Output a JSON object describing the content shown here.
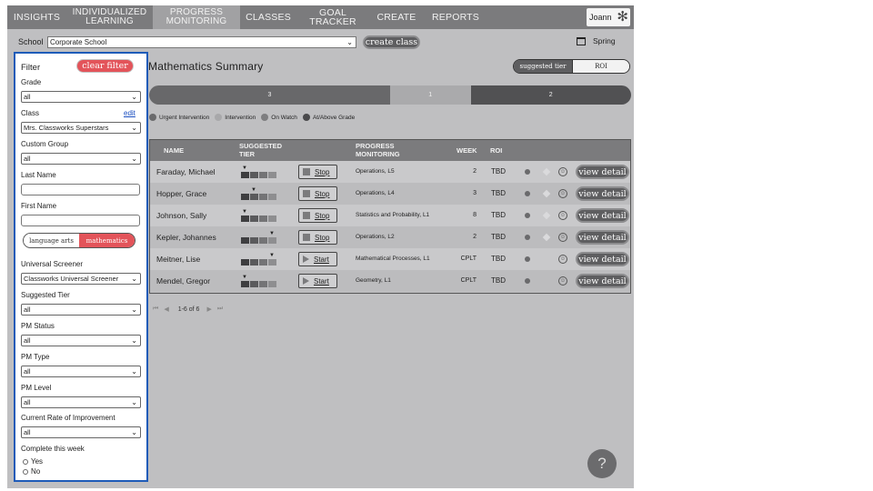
{
  "nav": {
    "items": [
      {
        "label": "INSIGHTS",
        "active": false
      },
      {
        "label": "INDIVIDUALIZED LEARNING",
        "active": false
      },
      {
        "label": "PROGRESS MONITORING",
        "active": true
      },
      {
        "label": "CLASSES",
        "active": false
      },
      {
        "label": "GOAL TRACKER",
        "active": false
      },
      {
        "label": "CREATE",
        "active": false
      },
      {
        "label": "REPORTS",
        "active": false
      }
    ],
    "user": "Joann",
    "gear_icon": "gear-icon"
  },
  "school_bar": {
    "label": "School",
    "school_value": "Corporate School",
    "create_class": "create class",
    "term": "Spring"
  },
  "filter": {
    "title": "Filter",
    "clear": "clear filter",
    "grade": {
      "label": "Grade",
      "value": "all"
    },
    "class": {
      "label": "Class",
      "edit": "edit",
      "value": "Mrs. Classworks Superstars"
    },
    "custom_group": {
      "label": "Custom Group",
      "value": "all"
    },
    "last_name": {
      "label": "Last Name",
      "value": ""
    },
    "first_name": {
      "label": "First Name",
      "value": ""
    },
    "subjects": {
      "language_arts": "language arts",
      "mathematics": "mathematics",
      "selected": "mathematics"
    },
    "universal_screener": {
      "label": "Universal Screener",
      "value": "Classworks Universal Screener"
    },
    "suggested_tier": {
      "label": "Suggested Tier",
      "value": "all"
    },
    "pm_status": {
      "label": "PM Status",
      "value": "all"
    },
    "pm_type": {
      "label": "PM Type",
      "value": "all"
    },
    "pm_level": {
      "label": "PM Level",
      "value": "all"
    },
    "rate": {
      "label": "Current Rate of Improvement",
      "value": "all"
    },
    "complete_week": {
      "label": "Complete this week",
      "yes": "Yes",
      "no": "No"
    }
  },
  "main": {
    "title": "Mathematics Summary",
    "toggle": {
      "on": "suggested tier",
      "off": "ROI"
    },
    "distribution": [
      {
        "label": "3",
        "share": 0.5,
        "color": "#68686a"
      },
      {
        "label": "1",
        "share": 0.167,
        "color": "#aaaaac"
      },
      {
        "label": "2",
        "share": 0.333,
        "color": "#515153"
      }
    ],
    "legend": [
      {
        "label": "Urgent Intervention",
        "color": "#6a6a6c"
      },
      {
        "label": "Intervention",
        "color": "#a8a8aa"
      },
      {
        "label": "On Watch",
        "color": "#7e7e80"
      },
      {
        "label": "At/Above Grade",
        "color": "#4a4a4c"
      }
    ],
    "headers": {
      "name": "NAME",
      "tier": "SUGGESTED TIER",
      "pm": "PROGRESS MONITORING",
      "week": "WEEK",
      "roi": "ROI"
    },
    "rows": [
      {
        "name": "Faraday, Michael",
        "tier": 1,
        "action": "Stop",
        "pm": "Operations, L5",
        "week": "2",
        "roi": "TBD",
        "diamond": true,
        "detail": "view detail"
      },
      {
        "name": "Hopper, Grace",
        "tier": 2,
        "action": "Stop",
        "pm": "Operations, L4",
        "week": "3",
        "roi": "TBD",
        "diamond": true,
        "detail": "view detail"
      },
      {
        "name": "Johnson, Sally",
        "tier": 1,
        "action": "Stop",
        "pm": "Statistics and Probability, L1",
        "week": "8",
        "roi": "TBD",
        "diamond": true,
        "detail": "view detail"
      },
      {
        "name": "Kepler, Johannes",
        "tier": 4,
        "action": "Stop",
        "pm": "Operations, L2",
        "week": "2",
        "roi": "TBD",
        "diamond": true,
        "detail": "view detail"
      },
      {
        "name": "Meitner, Lise",
        "tier": 4,
        "action": "Start",
        "pm": "Mathematical Processes, L1",
        "week": "CPLT",
        "roi": "TBD",
        "diamond": false,
        "detail": "view detail"
      },
      {
        "name": "Mendel, Gregor",
        "tier": 1,
        "action": "Start",
        "pm": "Geometry, L1",
        "week": "CPLT",
        "roi": "TBD",
        "diamond": false,
        "detail": "view detail"
      }
    ],
    "pager": "1-6 of 6",
    "help": "?"
  }
}
